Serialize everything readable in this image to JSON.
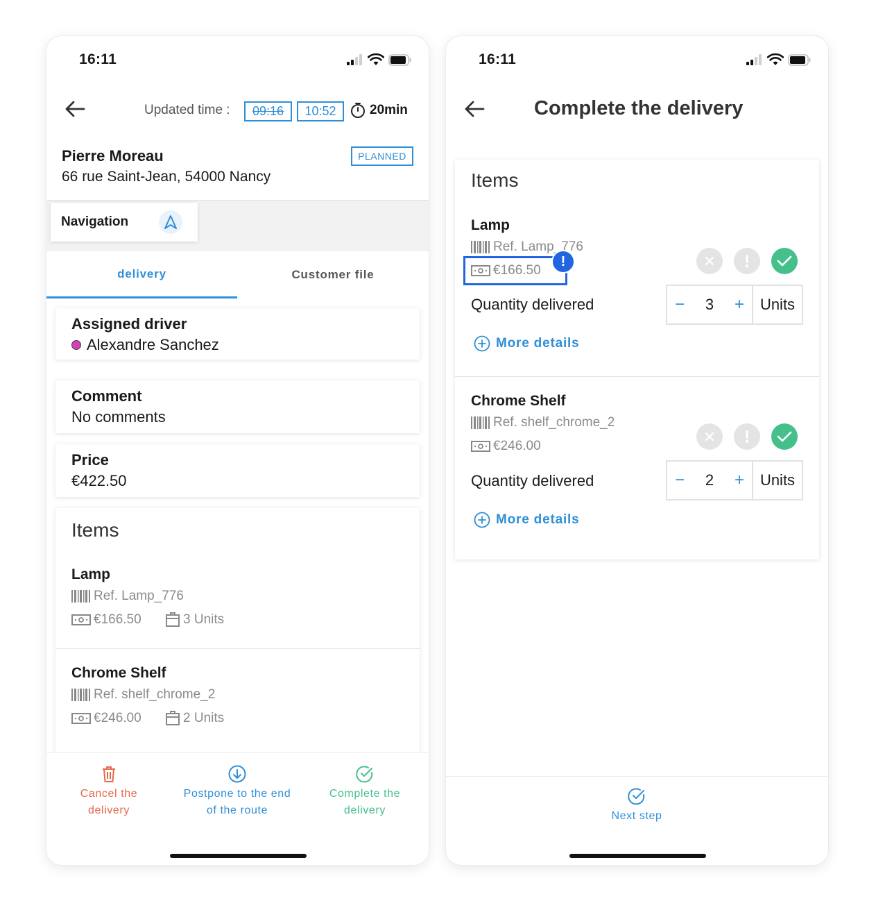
{
  "left": {
    "status_time": "16:11",
    "updated_time_label": "Updated time :",
    "old_time": "09:16",
    "new_time": "10:52",
    "duration": "20min",
    "customer_name": "Pierre Moreau",
    "address": "66 rue Saint-Jean, 54000 Nancy",
    "status_badge": "PLANNED",
    "navigation_label": "Navigation",
    "tabs": [
      {
        "label": "delivery",
        "active": true
      },
      {
        "label": "Customer file",
        "active": false
      }
    ],
    "driver": {
      "title": "Assigned driver",
      "name": "Alexandre Sanchez",
      "dot_color": "#d63fb7"
    },
    "comment": {
      "title": "Comment",
      "value": "No comments"
    },
    "price": {
      "title": "Price",
      "value": "€422.50"
    },
    "items_title": "Items",
    "items": [
      {
        "name": "Lamp",
        "ref": "Ref. Lamp_776",
        "price": "€166.50",
        "units": "3 Units"
      },
      {
        "name": "Chrome Shelf",
        "ref": "Ref. shelf_chrome_2",
        "price": "€246.00",
        "units": "2 Units"
      }
    ],
    "actions": {
      "cancel": "Cancel the delivery",
      "postpone": "Postpone to the end of the route",
      "complete": "Complete the delivery"
    }
  },
  "right": {
    "status_time": "16:11",
    "title": "Complete the delivery",
    "items_title": "Items",
    "quantity_label": "Quantity delivered",
    "more_details": "More details",
    "units_label": "Units",
    "items": [
      {
        "name": "Lamp",
        "ref": "Ref. Lamp_776",
        "price": "€166.50",
        "quantity": "3"
      },
      {
        "name": "Chrome Shelf",
        "ref": "Ref. shelf_chrome_2",
        "price": "€246.00",
        "quantity": "2"
      }
    ],
    "highlight_marker": "!",
    "next_step": "Next step"
  },
  "colors": {
    "accent_blue": "#2f8fd8",
    "cancel_red": "#e8674a",
    "complete_green": "#45c08a",
    "highlight_blue": "#2166e0"
  }
}
